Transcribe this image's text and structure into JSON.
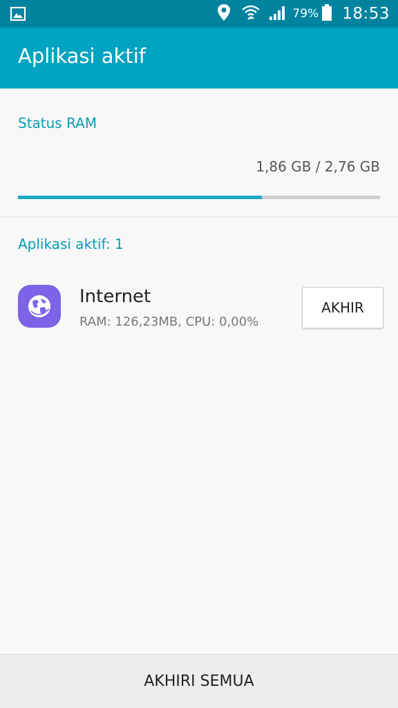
{
  "status_bar": {
    "battery_percent": "79%",
    "time": "18:53",
    "icons": [
      "gallery-icon",
      "location-icon",
      "wifi-icon",
      "signal-icon",
      "battery-icon"
    ]
  },
  "app_bar": {
    "title": "Aplikasi aktif"
  },
  "ram": {
    "title": "Status RAM",
    "usage_text": "1,86 GB / 2,76 GB",
    "used_fraction": 0.674
  },
  "active_apps": {
    "title": "Aplikasi aktif: 1",
    "items": [
      {
        "name": "Internet",
        "stats": "RAM: 126,23MB, CPU: 0,00%",
        "end_label": "AKHIR",
        "icon": "globe-icon"
      }
    ]
  },
  "footer": {
    "end_all_label": "AKHIRI SEMUA"
  },
  "colors": {
    "status_bar": "#00839f",
    "app_bar": "#00a3c0",
    "accent_text": "#0a9ab5",
    "progress_fill": "#1aa7c4",
    "progress_track": "#cfcfcf",
    "internet_icon_bg": "#7c63e8"
  }
}
